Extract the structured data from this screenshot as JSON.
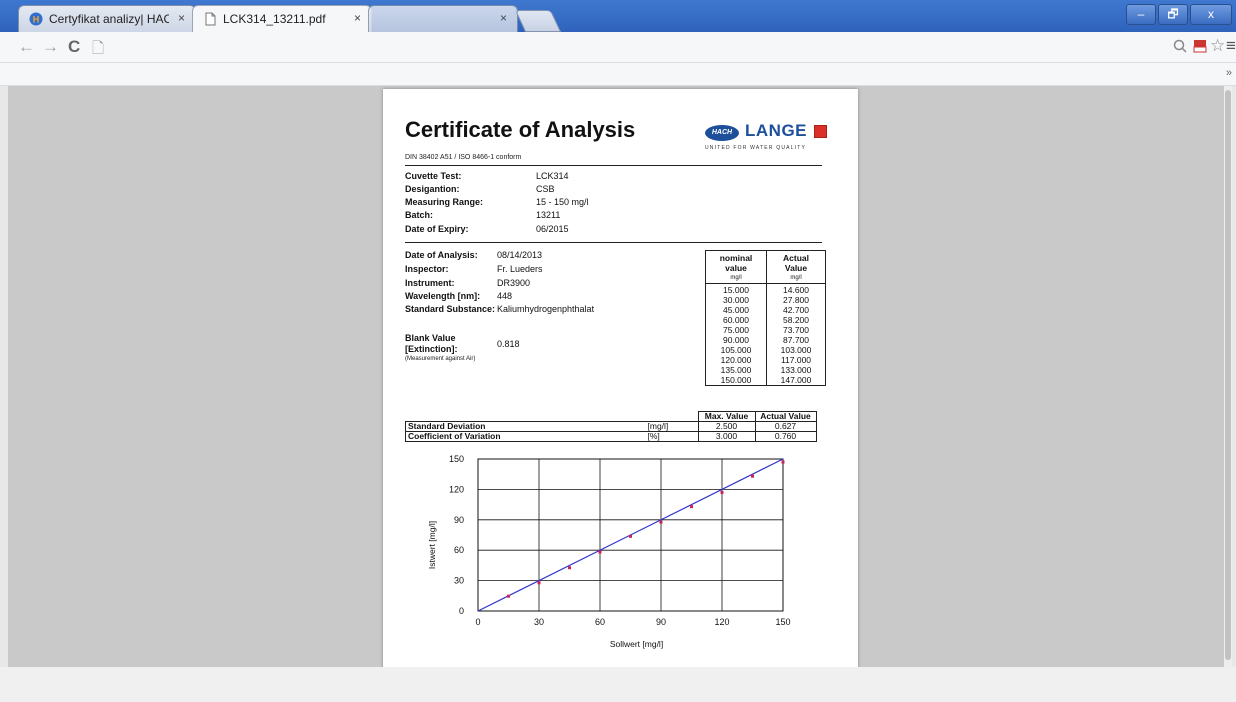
{
  "browser": {
    "tabs": [
      {
        "title": "Certyfikat analizy| HACH L",
        "close": "×",
        "active": false
      },
      {
        "title": "LCK314_13211.pdf",
        "close": "×",
        "active": true
      },
      {
        "title": "",
        "close": "×",
        "active": false
      }
    ],
    "window_buttons": {
      "minimize": "–",
      "maximize": "🗗",
      "close": "x"
    },
    "nav": {
      "back": "←",
      "forward": "→",
      "reload": "C",
      "page_icon": "🗋"
    },
    "address": "",
    "toolbar_icons": {
      "zoom": "🔍",
      "pdf": "PDF",
      "star": "☆",
      "menu": "≡"
    },
    "bookmarks_more": "»"
  },
  "certificate": {
    "title": "Certificate of Analysis",
    "conform": "DIN 38402 A51 / ISO 8466-1 conform",
    "logo": {
      "badge": "HACH",
      "word": "LANGE",
      "tagline": "UNITED FOR WATER QUALITY"
    },
    "product": [
      {
        "label": "Cuvette Test:",
        "value": "LCK314"
      },
      {
        "label": "Desigantion:",
        "value": "CSB"
      },
      {
        "label": "Measuring Range:",
        "value": "15 - 150 mg/l"
      },
      {
        "label": "Batch:",
        "value": "13211"
      },
      {
        "label": "Date of Expiry:",
        "value": "06/2015"
      }
    ],
    "analysis": [
      {
        "label": "Date of Analysis:",
        "value": "08/14/2013"
      },
      {
        "label": "Inspector:",
        "value": "Fr. Lueders"
      },
      {
        "label": "Instrument:",
        "value": "DR3900"
      },
      {
        "label": "Wavelength [nm]:",
        "value": "448"
      },
      {
        "label": "Standard Substance:",
        "value": "Kaliumhydrogenphthalat"
      }
    ],
    "blank": {
      "label1": "Blank Value",
      "label2": "[Extinction]:",
      "value": "0.818",
      "note": "(Measurement against Air)"
    },
    "nominal_table": {
      "head_nominal": [
        "nominal",
        "value"
      ],
      "head_actual": [
        "Actual",
        "Value"
      ],
      "unit": "mg/l",
      "nominal": [
        "15.000",
        "30.000",
        "45.000",
        "60.000",
        "75.000",
        "90.000",
        "105.000",
        "120.000",
        "135.000",
        "150.000"
      ],
      "actual": [
        "14.600",
        "27.800",
        "42.700",
        "58.200",
        "73.700",
        "87.700",
        "103.000",
        "117.000",
        "133.000",
        "147.000"
      ]
    },
    "stats": {
      "head_max": "Max. Value",
      "head_actual": "Actual Value",
      "rows": [
        {
          "label": "Standard Deviation",
          "unit": "[mg/l]",
          "max": "2.500",
          "actual": "0.627"
        },
        {
          "label": "Coefficient of Variation",
          "unit": "[%]",
          "max": "3.000",
          "actual": "0.760"
        }
      ]
    }
  },
  "chart_data": {
    "type": "scatter",
    "xlabel": "Sollwert [mg/l]",
    "ylabel": "Istwert [mg/l]",
    "xlim": [
      0,
      150
    ],
    "ylim": [
      0,
      150
    ],
    "xticks": [
      "0",
      "30",
      "60",
      "90",
      "120",
      "150"
    ],
    "yticks": [
      "0",
      "30",
      "60",
      "90",
      "120",
      "150"
    ],
    "grid": true,
    "line": {
      "x": [
        0,
        150
      ],
      "y": [
        0,
        150
      ],
      "color": "#3333cc"
    },
    "points_color": "#cc2255",
    "x": [
      15,
      30,
      45,
      60,
      75,
      90,
      105,
      120,
      135,
      150
    ],
    "y": [
      14.6,
      27.8,
      42.7,
      58.2,
      73.7,
      87.7,
      103,
      117,
      133,
      147
    ]
  }
}
